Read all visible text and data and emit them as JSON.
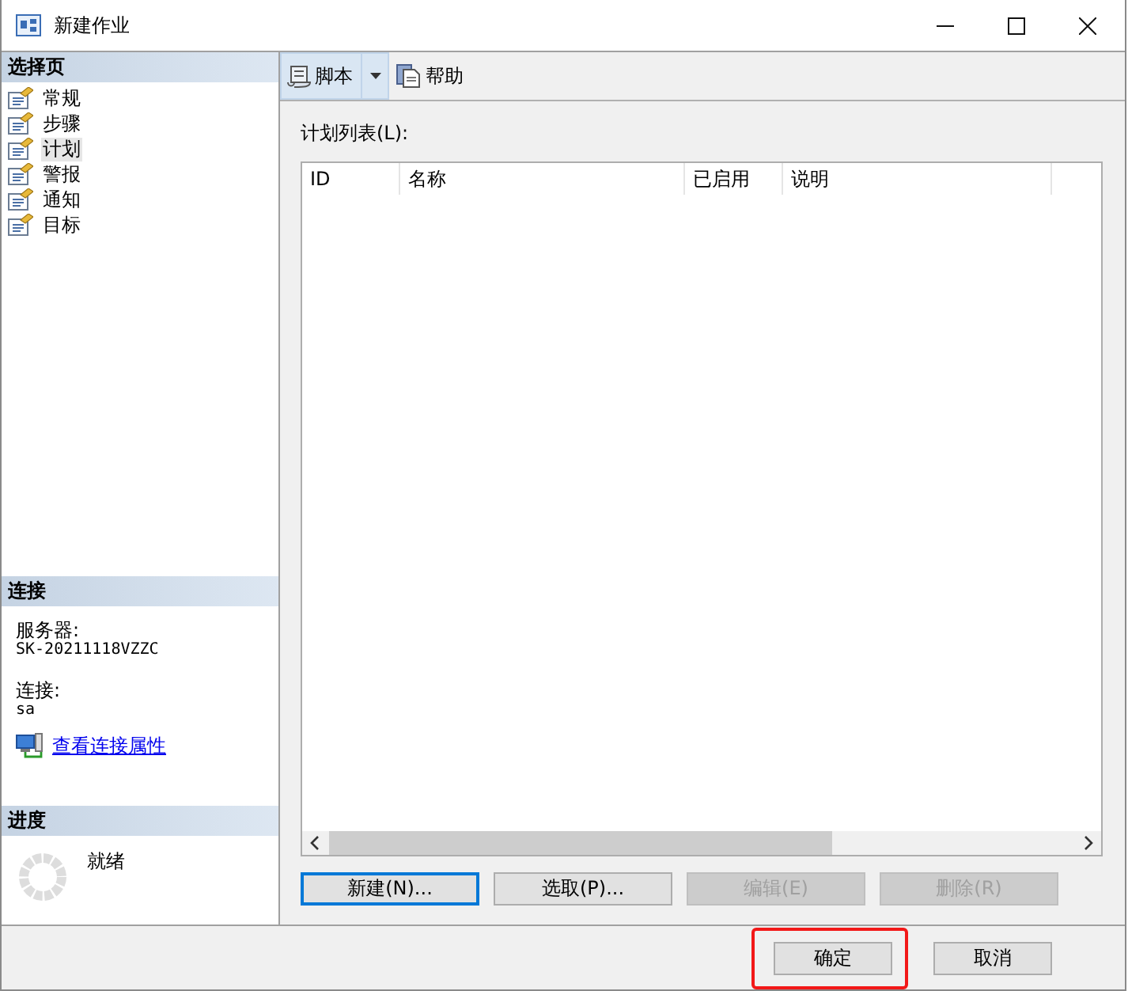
{
  "window": {
    "title": "新建作业"
  },
  "sidebar": {
    "header": "选择页",
    "pages": [
      {
        "label": "常规",
        "selected": false
      },
      {
        "label": "步骤",
        "selected": false
      },
      {
        "label": "计划",
        "selected": true
      },
      {
        "label": "警报",
        "selected": false
      },
      {
        "label": "通知",
        "selected": false
      },
      {
        "label": "目标",
        "selected": false
      }
    ]
  },
  "connection": {
    "header": "连接",
    "server_label": "服务器:",
    "server": "SK-20211118VZZC",
    "connection_label": "连接:",
    "user": "sa",
    "link": "查看连接属性"
  },
  "progress": {
    "header": "进度",
    "status": "就绪"
  },
  "toolbar": [
    {
      "kind": "script",
      "label": "脚本"
    },
    {
      "kind": "help",
      "label": "帮助"
    }
  ],
  "schedule_list": {
    "label": "计划列表(L):",
    "columns": [
      "ID",
      "名称",
      "已启用",
      "说明"
    ],
    "buttons": [
      {
        "label": "新建(N)...",
        "disabled": false,
        "focused": true
      },
      {
        "label": "选取(P)...",
        "disabled": false,
        "focused": false
      },
      {
        "label": "编辑(E)",
        "disabled": true,
        "focused": false
      },
      {
        "label": "删除(R)",
        "disabled": true,
        "focused": false
      }
    ]
  },
  "footer": {
    "buttons": [
      {
        "label": "确定",
        "highlighted": true
      },
      {
        "label": "取消",
        "highlighted": false
      }
    ]
  }
}
